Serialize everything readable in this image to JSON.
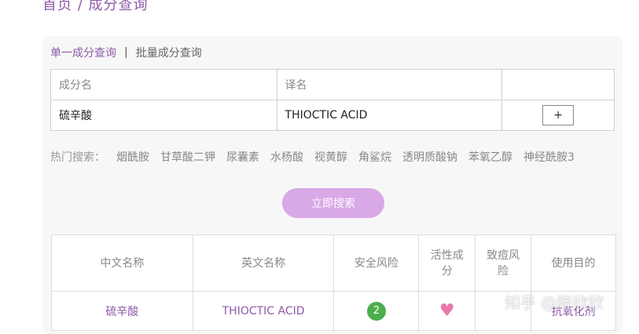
{
  "breadcrumb": "首页 / 成分查询",
  "tabs": {
    "single": "单一成分查询",
    "separator": "|",
    "batch": "批量成分查询"
  },
  "input_table": {
    "header_name": "成分名",
    "header_translation": "译名",
    "row_name": "硫辛酸",
    "row_translation": "THIOCTIC ACID",
    "add_label": "+"
  },
  "hot_search": {
    "label": "热门搜索：",
    "items": [
      "烟酰胺",
      "甘草酸二钾",
      "尿囊素",
      "水杨酸",
      "视黄醇",
      "角鲨烷",
      "透明质酸钠",
      "苯氧乙醇",
      "神经酰胺3"
    ]
  },
  "search_button": "立即搜索",
  "results": {
    "headers": [
      "中文名称",
      "英文名称",
      "安全风险",
      "活性成分",
      "致痘风险",
      "使用目的"
    ],
    "header_lines": {
      "active_1": "活性成",
      "active_2": "分",
      "acne_1": "致痘风",
      "acne_2": "险"
    },
    "rows": [
      {
        "cn_name": "硫辛酸",
        "en_name": "THIOCTIC ACID",
        "safety_risk": "2",
        "active_icon": "heart-icon",
        "acne_risk": "",
        "purpose": "抗氧化剂"
      }
    ]
  },
  "watermark": "知乎 @晓欣欣",
  "colors": {
    "accent": "#8e5aa8",
    "button": "#d9a8e6",
    "badge_green": "#4cae4c",
    "heart_pink": "#e879a8"
  }
}
